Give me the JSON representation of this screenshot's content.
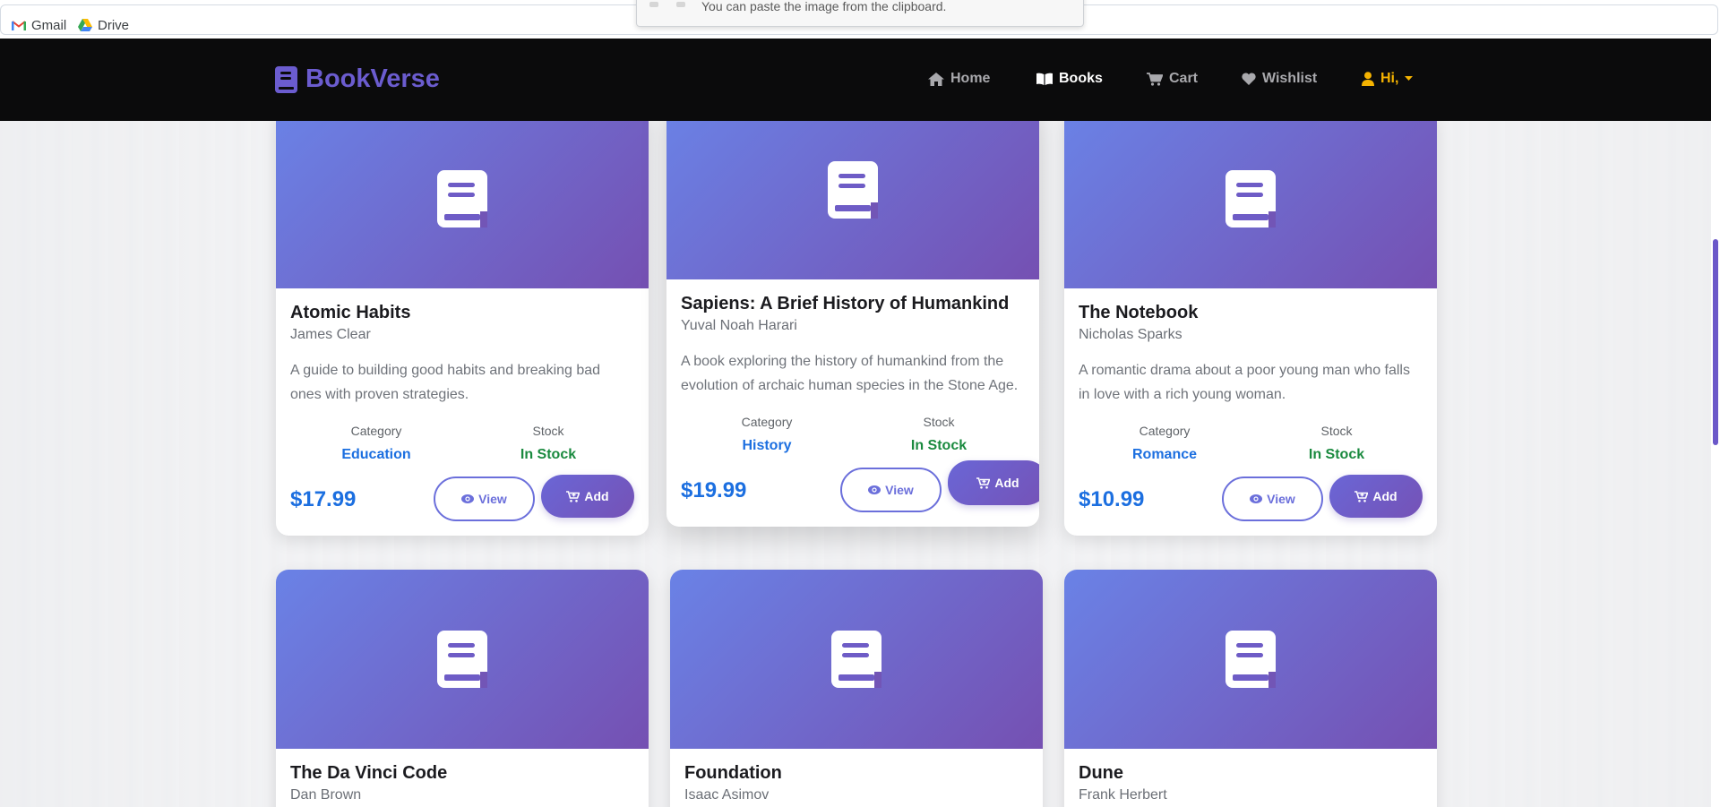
{
  "browser": {
    "bookmarks": [
      {
        "label": "Gmail",
        "icon": "gmail-icon"
      },
      {
        "label": "Drive",
        "icon": "drive-icon"
      }
    ],
    "clipboard_hint": "You can paste the image from the clipboard."
  },
  "navbar": {
    "brand": "BookVerse",
    "brand_icon": "book-icon",
    "brand_color": "#6b5ccf",
    "links": [
      {
        "label": "Home",
        "icon": "home-icon",
        "active": false
      },
      {
        "label": "Books",
        "icon": "open-book-icon",
        "active": true
      },
      {
        "label": "Cart",
        "icon": "cart-icon",
        "active": false
      },
      {
        "label": "Wishlist",
        "icon": "heart-icon",
        "active": false
      }
    ],
    "user_label": "Hi,"
  },
  "labels": {
    "category": "Category",
    "stock": "Stock",
    "view": "View",
    "add": "Add"
  },
  "books": [
    {
      "title": "Atomic Habits",
      "author": "James Clear",
      "description": "A guide to building good habits and breaking bad ones with proven strategies.",
      "category": "Education",
      "stock": "In Stock",
      "price": "$17.99"
    },
    {
      "title": "Sapiens: A Brief History of Humankind",
      "author": "Yuval Noah Harari",
      "description": "A book exploring the history of humankind from the evolution of archaic human species in the Stone Age.",
      "category": "History",
      "stock": "In Stock",
      "price": "$19.99"
    },
    {
      "title": "The Notebook",
      "author": "Nicholas Sparks",
      "description": "A romantic drama about a poor young man who falls in love with a rich young woman.",
      "category": "Romance",
      "stock": "In Stock",
      "price": "$10.99"
    },
    {
      "title": "The Da Vinci Code",
      "author": "Dan Brown"
    },
    {
      "title": "Foundation",
      "author": "Isaac Asimov"
    },
    {
      "title": "Dune",
      "author": "Frank Herbert"
    }
  ],
  "colors": {
    "accent": "#6b6fdb",
    "price": "#1c6fe0",
    "in_stock": "#1a8a3f",
    "user": "#f5b301"
  }
}
